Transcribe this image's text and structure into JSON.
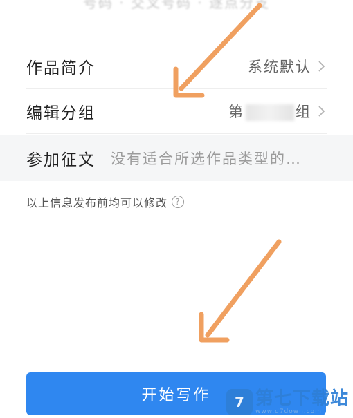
{
  "top_fade_text": "号码 · 交叉号码 · 逐点分支",
  "rows": {
    "intro": {
      "label": "作品简介",
      "value": "系统默认"
    },
    "group": {
      "label": "编辑分组",
      "value_prefix": "第",
      "value_suffix": "组"
    },
    "contest": {
      "label": "参加征文",
      "value": "没有适合所选作品类型的…"
    }
  },
  "hint": {
    "text": "以上信息发布前均可以修改",
    "help_glyph": "?"
  },
  "start_button": {
    "label": "开始写作"
  },
  "watermark": {
    "main": "第七下载站",
    "sub": "www.d7down.com"
  },
  "colors": {
    "accent": "#2f87f0",
    "arrow": "#f0a060",
    "contest_bg": "#f5f6f7"
  }
}
